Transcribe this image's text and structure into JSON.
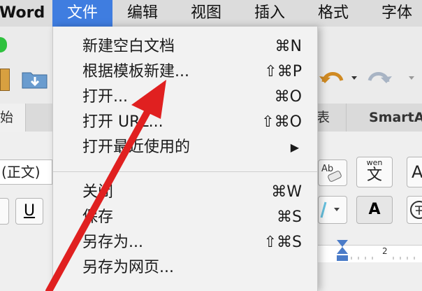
{
  "menubar": {
    "app": "Word",
    "items": [
      "文件",
      "编辑",
      "视图",
      "插入",
      "格式",
      "字体"
    ]
  },
  "file_menu": {
    "items": [
      {
        "label": "新建空白文档",
        "shortcut": "⌘N"
      },
      {
        "label": "根据模板新建...",
        "shortcut": "⇧⌘P"
      },
      {
        "label": "打开...",
        "shortcut": "⌘O"
      },
      {
        "label": "打开 URL...",
        "shortcut": "⇧⌘O"
      },
      {
        "label": "打开最近使用的",
        "shortcut": "▶"
      },
      {
        "label": "关闭",
        "shortcut": "⌘W"
      },
      {
        "label": "保存",
        "shortcut": "⌘S"
      },
      {
        "label": "另存为...",
        "shortcut": "⇧⌘S"
      },
      {
        "label": "另存为网页...",
        "shortcut": ""
      }
    ]
  },
  "ribbon": {
    "tab_left": "始",
    "tab_partial": "表",
    "tab_smartart": "SmartA",
    "font_name": "(正文)",
    "underline": "U",
    "wen_label": "wen",
    "wen_char": "文",
    "char_a": "A",
    "ruler_mark": "2"
  },
  "colors": {
    "accent": "#3f7de0",
    "arrow": "#e02020"
  }
}
